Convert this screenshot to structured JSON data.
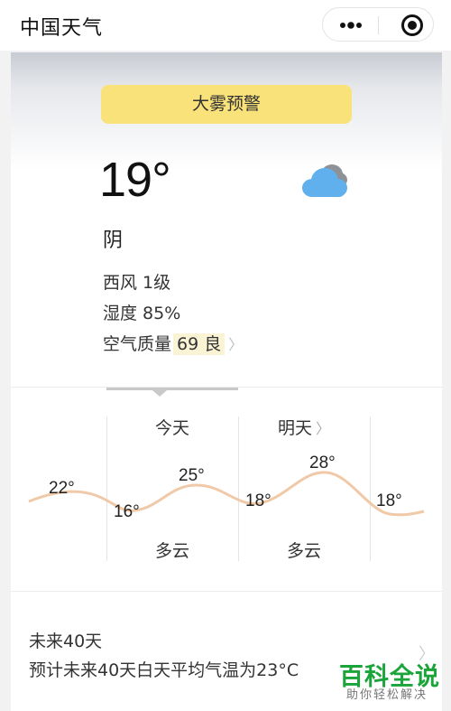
{
  "app": {
    "title": "中国天气"
  },
  "capsule": {
    "more_icon": "more-dots-icon",
    "close_icon": "target-circle-icon"
  },
  "current": {
    "alert": "大雾预警",
    "temperature": "19°",
    "condition": "阴",
    "wind": "西风 1级",
    "humidity": "湿度 85%",
    "air_quality_label": "空气质量",
    "air_quality_value": "69 良",
    "icon": "cloudy-icon"
  },
  "forecast": {
    "days": [
      {
        "label": "今天",
        "weather": "多云"
      },
      {
        "label": "明天",
        "weather": "多云"
      }
    ],
    "highs": [
      "22°",
      "25°",
      "28°"
    ],
    "lows": [
      "16°",
      "18°",
      "18°"
    ],
    "curve_color": "#f0c9a8"
  },
  "forty_day": {
    "title": "未来40天",
    "description": "预计未来40天白天平均气温为23°C"
  },
  "watermark": {
    "main": "百科全说",
    "sub": "助你轻松解决"
  }
}
